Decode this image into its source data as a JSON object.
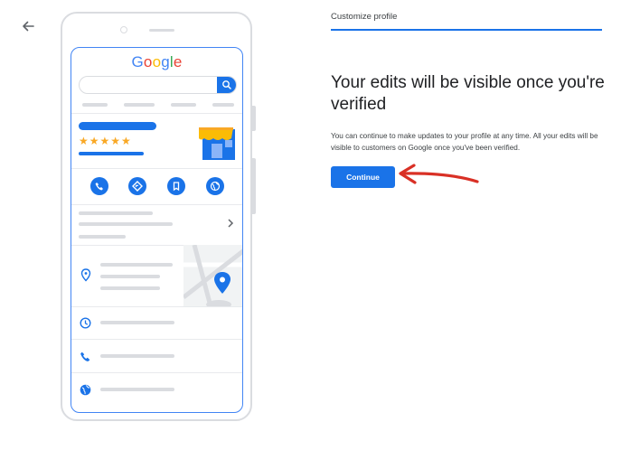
{
  "nav": {
    "back_icon": "arrow-left-icon"
  },
  "header": {
    "title": "Customize profile"
  },
  "main": {
    "heading": "Your edits will be visible once you're verified",
    "description": "You can continue to make updates to your profile at any time. All your edits will be visible to customers on Google once you've been verified.",
    "continue_label": "Continue"
  },
  "illustration": {
    "logo_letters": [
      "G",
      "o",
      "o",
      "g",
      "l",
      "e"
    ],
    "logo_colors": [
      "#4285f4",
      "#ea4335",
      "#fbbc05",
      "#4285f4",
      "#34a853",
      "#ea4335"
    ],
    "stars": "★★★★★",
    "rating_count": 5,
    "actions": [
      "phone-icon",
      "directions-icon",
      "bookmark-icon",
      "website-icon"
    ],
    "rows": [
      "location-pin-icon",
      "clock-icon",
      "phone-icon",
      "globe-icon"
    ]
  },
  "colors": {
    "accent": "#1a73e8",
    "annotation_arrow": "#d93025",
    "star": "#f9a825"
  }
}
